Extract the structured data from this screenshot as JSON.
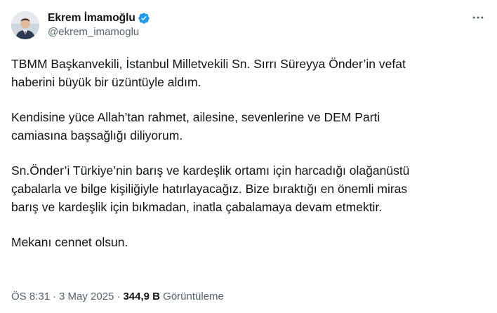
{
  "author": {
    "display_name": "Ekrem İmamoğlu",
    "handle": "@ekrem_imamoglu",
    "verified": true,
    "verified_color": "#1d9bf0",
    "avatar_icon": "profile-photo"
  },
  "more_icon": "more-horizontal-icon",
  "tweet": {
    "paragraphs": [
      "TBMM Başkanvekili, İstanbul Milletvekili Sn. Sırrı Süreyya Önder’in vefat\nhaberini büyük bir üzüntüyle aldım.",
      "Kendisine yüce Allah’tan rahmet, ailesine, sevenlerine ve DEM Parti\ncamiasına başsağlığı diliyorum.",
      "Sn.Önder’i Türkiye’nin barış ve kardeşlik ortamı için harcadığı olağanüstü\nçabalarla ve bilge kişiliğiyle hatırlayacağız. Bize bıraktığı en önemli miras\nbarış ve kardeşlik için bıkmadan, inatla çabalamaya devam etmektir.",
      "Mekanı cennet olsun."
    ],
    "time": "ÖS 8:31",
    "separator": "·",
    "date": "3 May 2025",
    "views_count": "344,9 B",
    "views_label": "Görüntüleme"
  }
}
